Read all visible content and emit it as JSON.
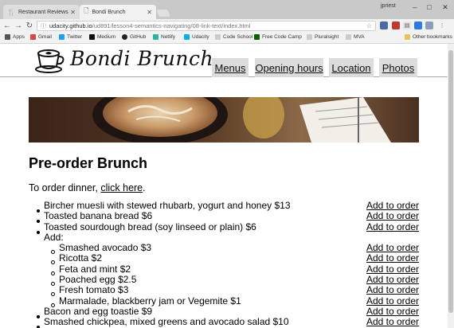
{
  "browser": {
    "tabs": [
      {
        "title": "Restaurant Reviews",
        "active": false
      },
      {
        "title": "Bondi Brunch",
        "active": true
      }
    ],
    "user": "jpriest",
    "url_host": "udacity.github.io",
    "url_path": "/ud891/lesson4-semantics-navigating/08-link-text/index.html",
    "bookmarks": [
      "Apps",
      "Gmail",
      "Twitter",
      "Medium",
      "GitHub",
      "Netlify",
      "Udacity",
      "Code School",
      "Free Code Camp",
      "Pluralsight",
      "MVA"
    ],
    "other_bookmarks": "Other bookmarks"
  },
  "site": {
    "title": "Bondi Brunch",
    "nav": [
      "Menus",
      "Opening hours",
      "Location",
      "Photos"
    ]
  },
  "main": {
    "heading": "Pre-order Brunch",
    "intro_prefix": "To order dinner, ",
    "intro_link": "click here",
    "intro_suffix": ".",
    "order_label": "Add to order",
    "items": {
      "muesli": "Bircher muesli with stewed rhubarb, yogurt and honey $13",
      "banana": "Toasted banana bread $6",
      "sourdough": "Toasted sourdough bread (soy linseed or plain) $6",
      "add": "Add:",
      "avocado": "Smashed avocado $3",
      "ricotta": "Ricotta $2",
      "feta": "Feta and mint $2",
      "egg": "Poached egg $2.5",
      "tomato": "Fresh tomato $3",
      "marmalade": "Marmalade, blackberry jam or Vegemite $1",
      "toastie": "Bacon and egg toastie $9",
      "chickpea": "Smashed chickpea, mixed greens and avocado salad $10"
    }
  },
  "colors": {
    "nav_bg": "#dcdcdc",
    "chrome_frame": "#c9c9c9",
    "chrome_toolbar": "#f2f2f2"
  }
}
